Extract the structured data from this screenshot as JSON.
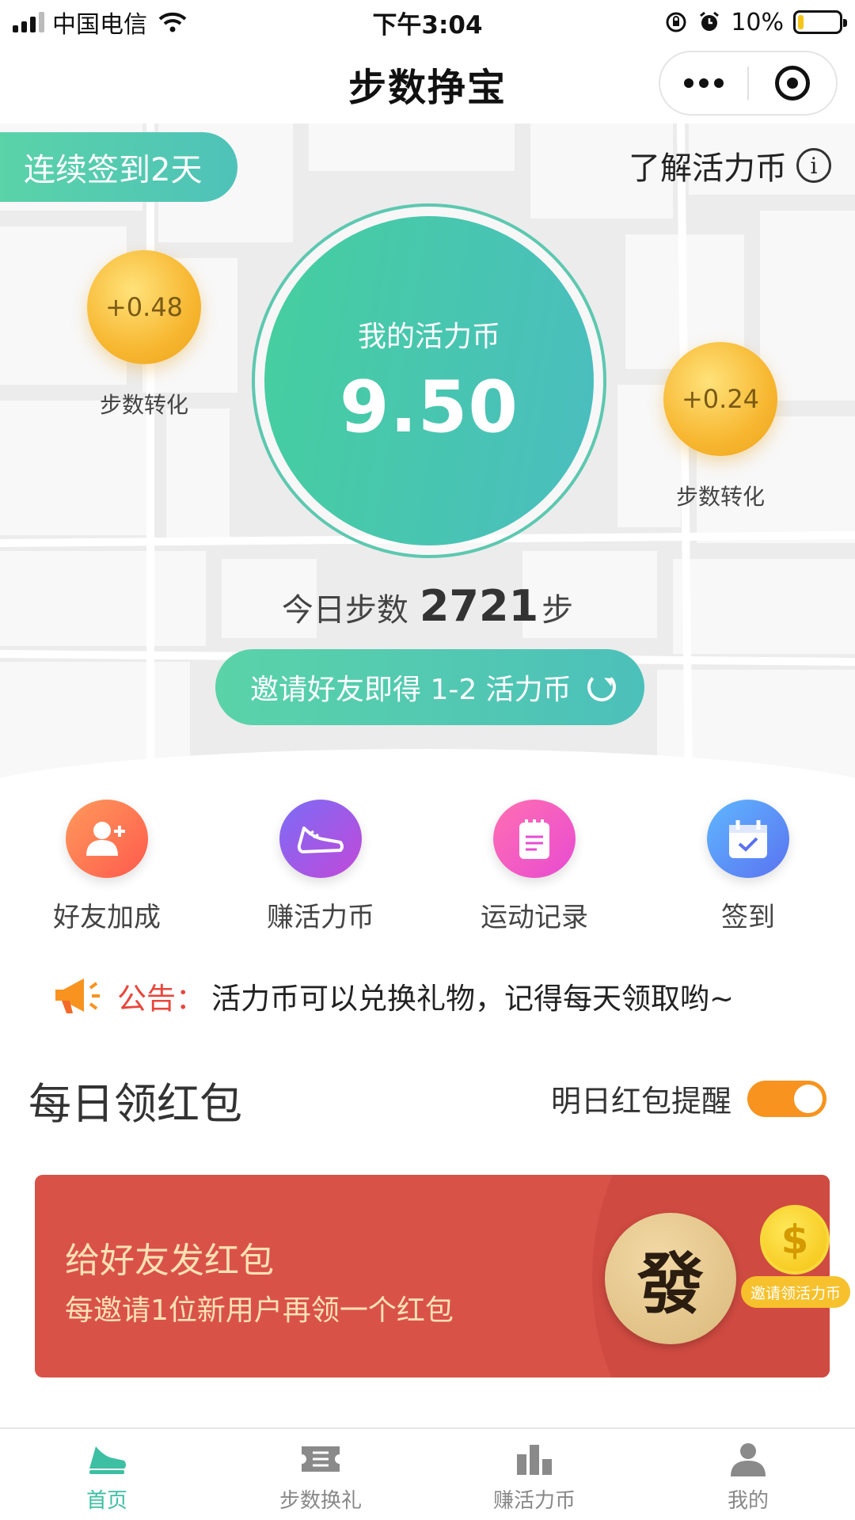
{
  "status_bar": {
    "carrier": "中国电信",
    "time": "下午3:04",
    "battery": "10%",
    "battery_level": 0.1
  },
  "header": {
    "title": "步数挣宝"
  },
  "hero": {
    "signin_badge": "连续签到2天",
    "about_link": "了解活力币",
    "coins": [
      {
        "value": "+0.48",
        "label": "步数转化"
      },
      {
        "value": "+0.24",
        "label": "步数转化"
      }
    ],
    "balance_label": "我的活力币",
    "balance_value": "9.50",
    "steps_prefix": "今日步数",
    "steps_value": "2721",
    "steps_unit": "步",
    "invite_button": "邀请好友即得 1-2 活力币"
  },
  "features": [
    {
      "label": "好友加成",
      "icon": "add-friend-icon"
    },
    {
      "label": "赚活力币",
      "icon": "sneaker-icon"
    },
    {
      "label": "运动记录",
      "icon": "notepad-icon"
    },
    {
      "label": "签到",
      "icon": "calendar-check-icon"
    }
  ],
  "notice": {
    "prefix": "公告：",
    "text": "活力币可以兑换礼物，记得每天领取哟~"
  },
  "red_packet": {
    "section_title": "每日领红包",
    "remind_label": "明日红包提醒",
    "remind_on": true,
    "card_title": "给好友发红包",
    "card_subtitle": "每邀请1位新用户再领一个红包",
    "seal_char": "發",
    "promo_tag": "邀请领活力币"
  },
  "tabs": [
    {
      "label": "首页",
      "icon": "shoe-icon",
      "active": true
    },
    {
      "label": "步数换礼",
      "icon": "ticket-icon",
      "active": false
    },
    {
      "label": "赚活力币",
      "icon": "bar-chart-icon",
      "active": false
    },
    {
      "label": "我的",
      "icon": "user-icon",
      "active": false
    }
  ],
  "colors": {
    "accent": "#4fc7ad",
    "coin": "#f7b731",
    "packet": "#d95248",
    "toggle": "#f7931e",
    "notice": "#e8463c"
  }
}
